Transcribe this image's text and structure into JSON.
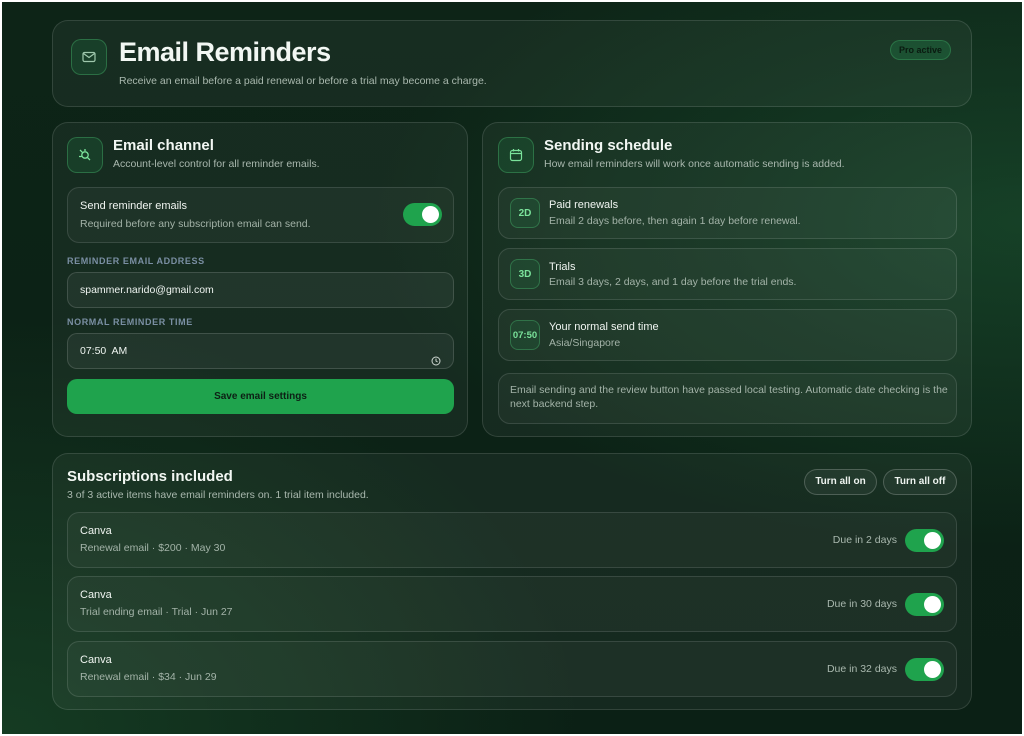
{
  "header": {
    "title": "Email Reminders",
    "subtitle": "Receive an email before a paid renewal or before a trial may become a charge.",
    "badge": "Pro active",
    "icon": "mail-icon"
  },
  "email_channel": {
    "title": "Email channel",
    "subtitle": "Account-level control for all reminder emails.",
    "icon": "plug-icon",
    "toggle_title": "Send reminder emails",
    "toggle_sub": "Required before any subscription email can send.",
    "toggle_on": true,
    "address_label": "REMINDER EMAIL ADDRESS",
    "address_value": "spammer.narido@gmail.com",
    "time_label": "NORMAL REMINDER TIME",
    "time_value": "07:50  AM",
    "save_label": "Save email settings"
  },
  "schedule": {
    "title": "Sending schedule",
    "subtitle": "How email reminders will work once automatic sending is added.",
    "icon": "calendar-icon",
    "items": [
      {
        "badge": "2D",
        "title": "Paid renewals",
        "sub": "Email 2 days before, then again 1 day before renewal."
      },
      {
        "badge": "3D",
        "title": "Trials",
        "sub": "Email 3 days, 2 days, and 1 day before the trial ends."
      },
      {
        "badge": "07:50",
        "title": "Your normal send time",
        "sub": "Asia/Singapore"
      }
    ],
    "note": "Email sending and the review button have passed local testing. Automatic date checking is the next backend step."
  },
  "subscriptions": {
    "title": "Subscriptions included",
    "subtitle": "3 of 3 active items have email reminders on. 1 trial item included.",
    "turn_all_on": "Turn all on",
    "turn_all_off": "Turn all off",
    "items": [
      {
        "name": "Canva",
        "detail": "Renewal email · $200 · May 30",
        "due": "Due in 2 days",
        "on": true
      },
      {
        "name": "Canva",
        "detail": "Trial ending email · Trial · Jun 27",
        "due": "Due in 30 days",
        "on": true
      },
      {
        "name": "Canva",
        "detail": "Renewal email · $34 · Jun 29",
        "due": "Due in 32 days",
        "on": true
      }
    ]
  },
  "colors": {
    "accent": "#1fa34d",
    "background": "#0c2216"
  }
}
